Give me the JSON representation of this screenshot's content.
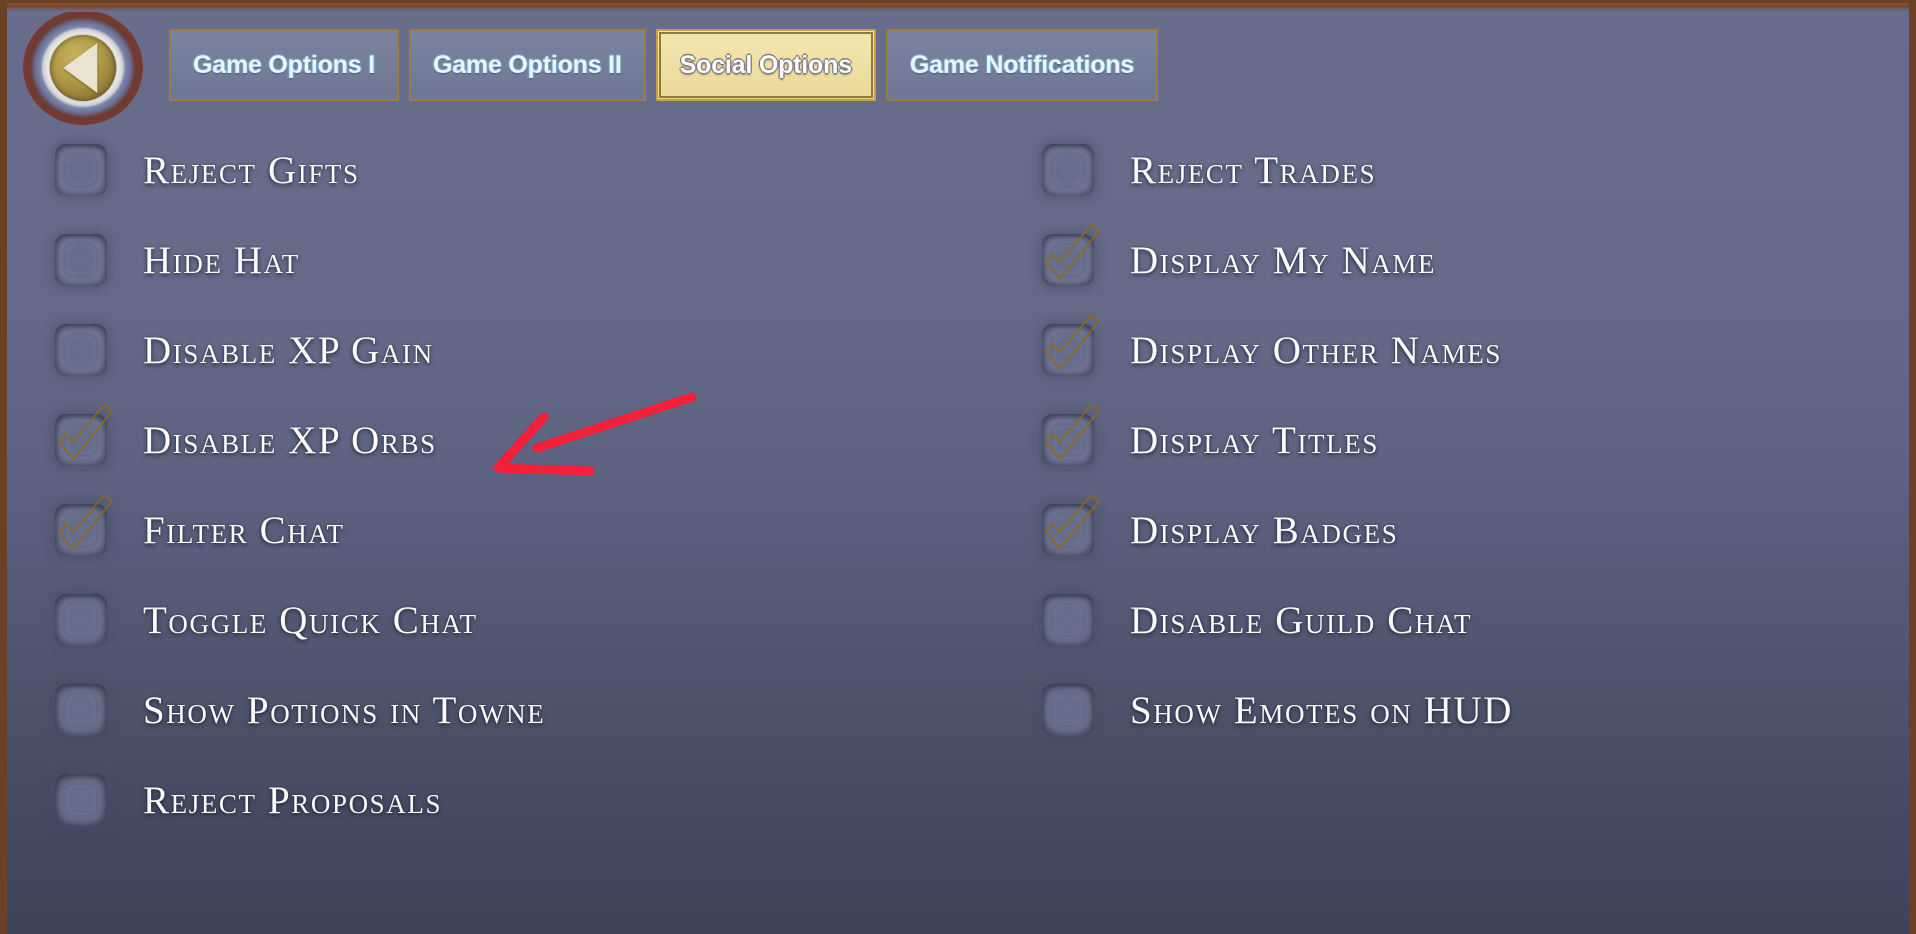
{
  "window": {
    "title": "Social Options",
    "frame_color": "#6b4126",
    "background_top_color": "#686d8c",
    "background_bottom_color": "#3e4457"
  },
  "header": {
    "back_button": {
      "name": "back",
      "icon": "left-triangle-icon",
      "label": ""
    },
    "tabs": [
      {
        "label": "Game Options I",
        "active": false
      },
      {
        "label": "Game Options II",
        "active": false
      },
      {
        "label": "Social Options",
        "active": true
      },
      {
        "label": "Game Notifications",
        "active": false
      }
    ],
    "active_tab_fill_color": "#efdfa4",
    "inactive_tab_fill_color": "#767d9b",
    "tab_border_color": "#97803f"
  },
  "options": {
    "checked_icon": "gold-checkmark-icon",
    "unchecked_icon": "empty-checkbox-icon",
    "checkmark_color": "#e8cf63",
    "left_column": [
      {
        "label": "Reject Gifts",
        "checked": false
      },
      {
        "label": "Hide Hat",
        "checked": false
      },
      {
        "label": "Disable XP Gain",
        "checked": false
      },
      {
        "label": "Disable XP Orbs",
        "checked": true
      },
      {
        "label": "Filter Chat",
        "checked": true
      },
      {
        "label": "Toggle Quick Chat",
        "checked": false
      },
      {
        "label": "Show Potions in Towne",
        "checked": false
      },
      {
        "label": "Reject Proposals",
        "checked": false
      }
    ],
    "right_column": [
      {
        "label": "Reject Trades",
        "checked": false
      },
      {
        "label": "Display My Name",
        "checked": true
      },
      {
        "label": "Display Other Names",
        "checked": true
      },
      {
        "label": "Display Titles",
        "checked": true
      },
      {
        "label": "Display Badges",
        "checked": true
      },
      {
        "label": "Disable Guild Chat",
        "checked": false
      },
      {
        "label": "Show Emotes on HUD",
        "checked": false
      }
    ]
  },
  "annotation": {
    "type": "hand-drawn-arrow",
    "color": "#f61f38",
    "points_at": "Disable XP Orbs"
  }
}
